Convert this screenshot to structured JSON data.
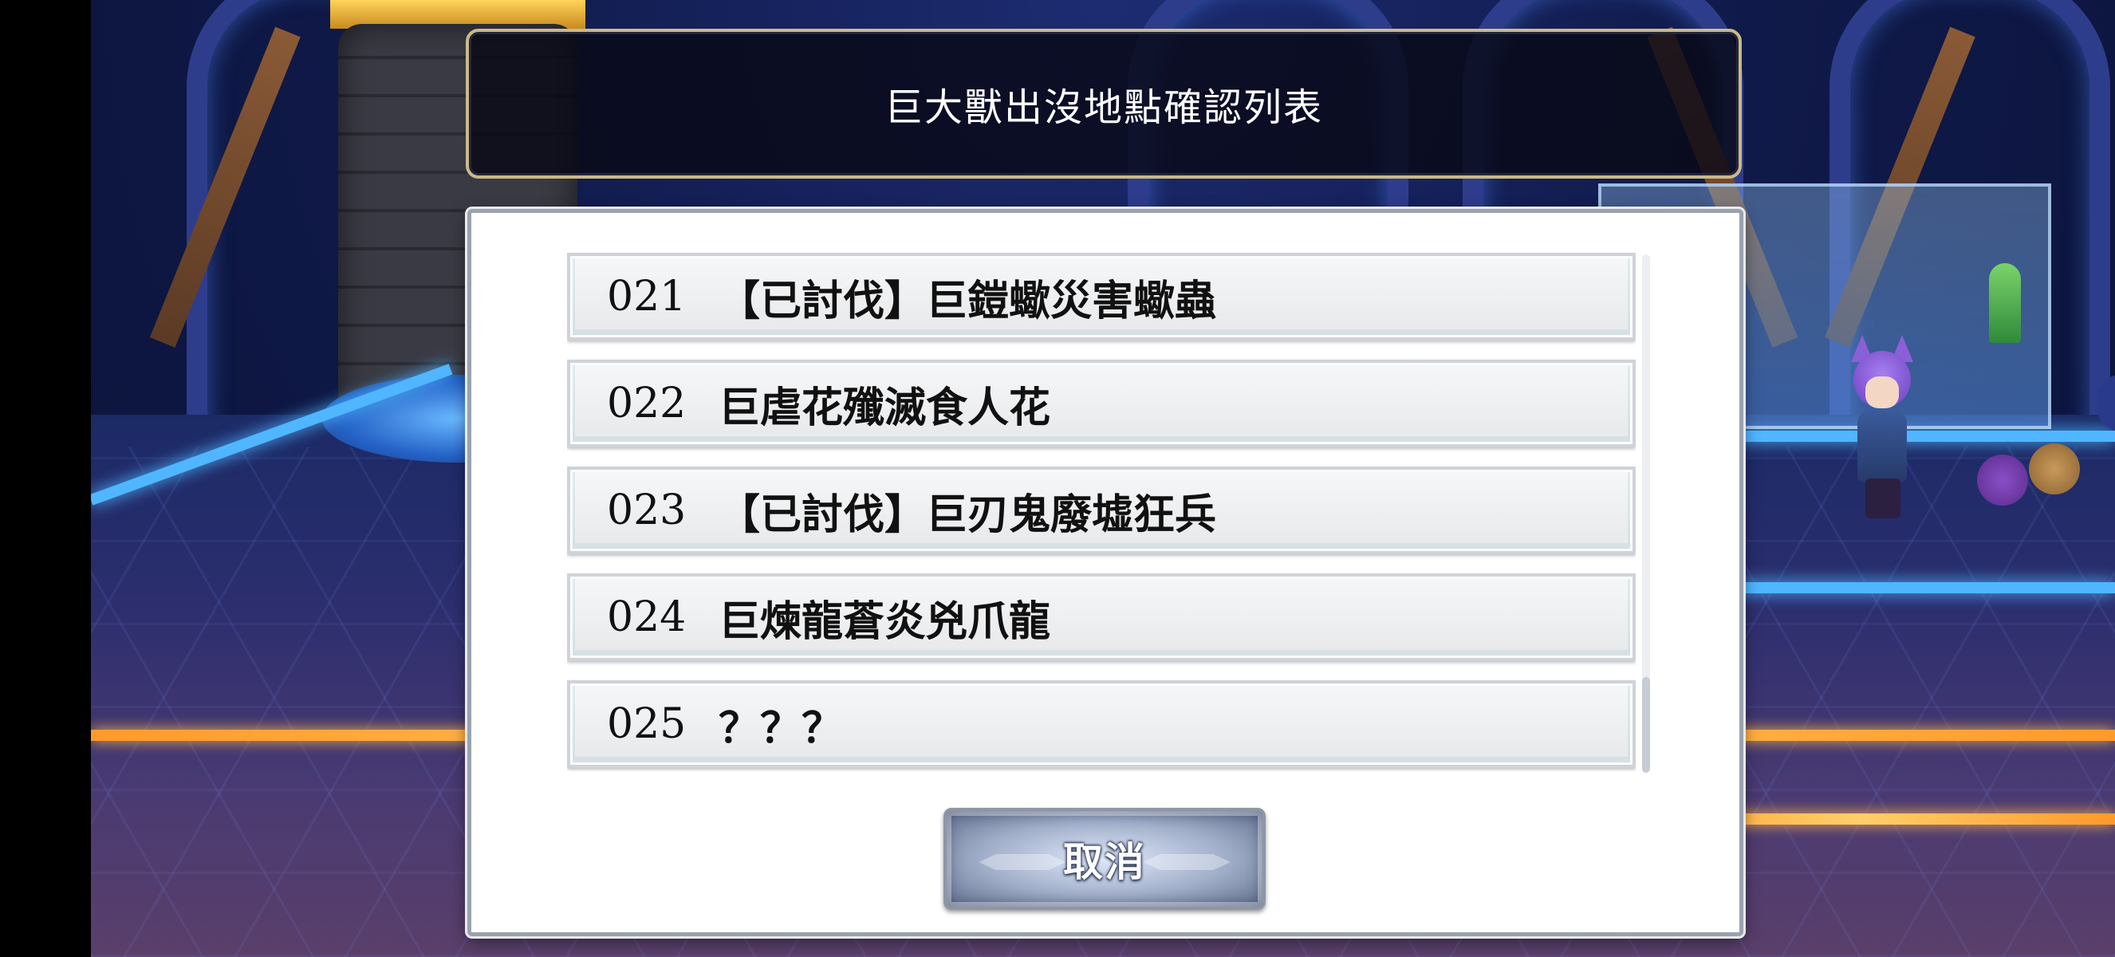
{
  "title": "巨大獸出沒地點確認列表",
  "list": {
    "items": [
      {
        "number": "021",
        "name": "【已討伐】巨鎧蠍災害蠍蟲"
      },
      {
        "number": "022",
        "name": "巨虐花殲滅食人花"
      },
      {
        "number": "023",
        "name": "【已討伐】巨刃鬼廢墟狂兵"
      },
      {
        "number": "024",
        "name": "巨煉龍蒼炎兇爪龍"
      },
      {
        "number": "025",
        "name": "？？？"
      }
    ]
  },
  "buttons": {
    "cancel_label": "取消"
  },
  "colors": {
    "title_border": "#c9b98a",
    "panel_background": "#ffffff",
    "neon_orange": "#ff9a2a",
    "neon_blue": "#4fb6ff"
  }
}
